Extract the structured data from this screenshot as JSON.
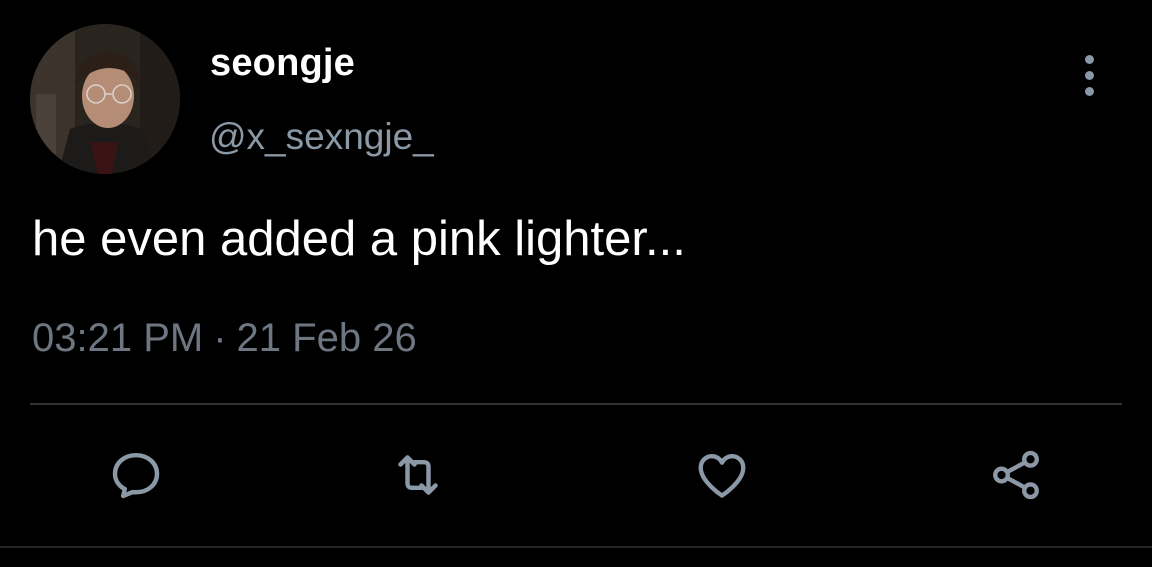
{
  "tweet": {
    "display_name": "seongje",
    "handle": "@x_sexngje_",
    "text": "he even added a pink lighter...",
    "time": "03:21 PM",
    "separator": "·",
    "date": "21 Feb 26"
  },
  "icons": {
    "more": "more-vertical-icon",
    "reply": "reply-icon",
    "retweet": "retweet-icon",
    "like": "heart-icon",
    "share": "share-icon"
  },
  "colors": {
    "background": "#000000",
    "primary_text": "#ffffff",
    "secondary_text": "#8b98a5",
    "meta_text": "#6e7781",
    "icon": "#8b98a5",
    "divider": "#2f3336"
  }
}
